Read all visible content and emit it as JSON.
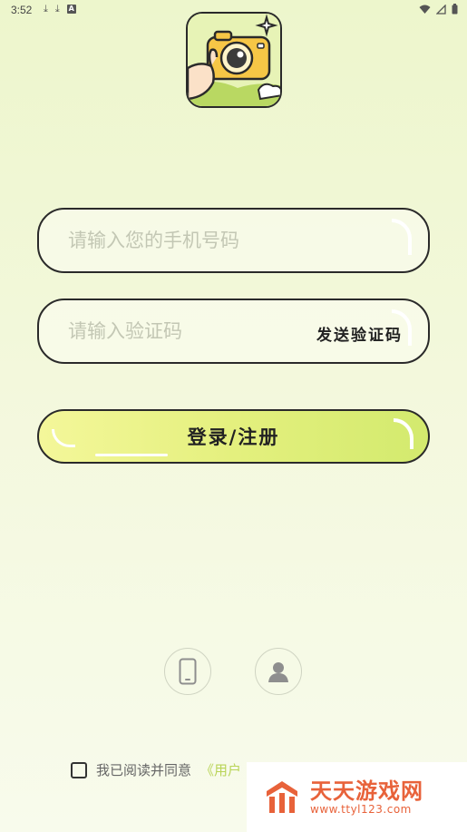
{
  "status_bar": {
    "time": "3:52",
    "left_icons": [
      "download-icon",
      "download-icon",
      "a-box-icon"
    ],
    "right_icons": [
      "wifi-icon",
      "signal-icon",
      "battery-icon"
    ]
  },
  "app": {
    "logo": "camera-hand-logo",
    "accent_color": "#d3ea6e"
  },
  "form": {
    "phone_placeholder": "请输入您的手机号码",
    "phone_value": "",
    "code_placeholder": "请输入验证码",
    "code_value": "",
    "send_code_label": "发送验证码",
    "login_label": "登录/注册"
  },
  "alt_login": {
    "phone_icon": "phone-icon",
    "user_icon": "user-icon"
  },
  "agreement": {
    "checked": false,
    "text": "我已阅读并同意",
    "link_text": "《用户"
  },
  "watermark": {
    "brand": "天天游戏网",
    "url": "www.ttyl123.com"
  }
}
